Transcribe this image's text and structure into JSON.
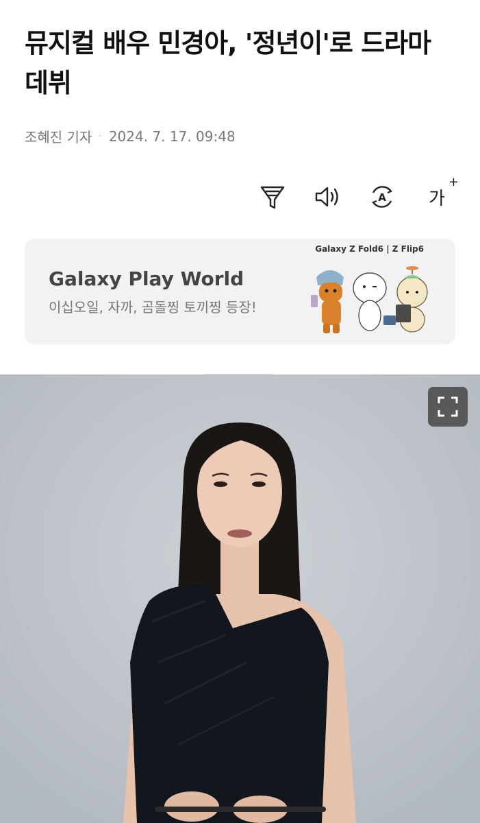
{
  "article": {
    "title": "뮤지컬 배우 민경아, '정년이'로 드라마 데뷔",
    "reporter": "조혜진 기자",
    "separator": "·",
    "datetime": "2024. 7. 17. 09:48"
  },
  "toolbar": {
    "font_size_label": "가",
    "font_size_plus": "+",
    "icons": [
      "filter-icon",
      "speaker-icon",
      "translate-icon",
      "font-size-icon"
    ],
    "translate_letter": "A"
  },
  "banner": {
    "brand": "Galaxy Z Fold6 | Z Flip6",
    "title": "Galaxy Play World",
    "subtitle": "이십오일, 자까, 곰돌찡 토끼찡 등장!"
  },
  "colors": {
    "photo_bg": "#c1c6cc",
    "banner_bg": "#f2f2f2",
    "accent_orange": "#d9822b"
  }
}
